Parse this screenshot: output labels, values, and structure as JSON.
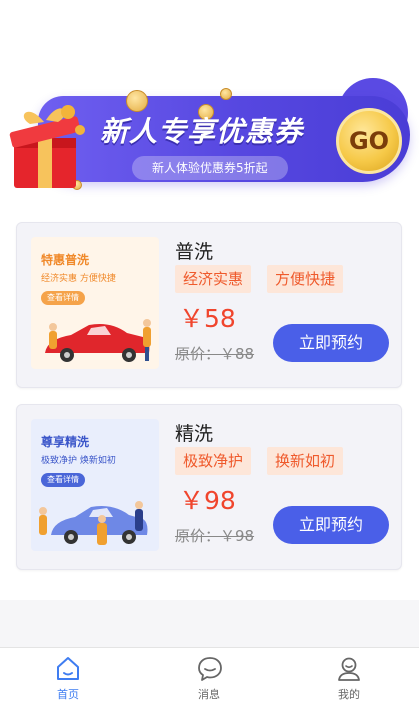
{
  "banner": {
    "title": "新人专享优惠券",
    "subtitle": "新人体验优惠券5折起",
    "go_label": "GO"
  },
  "services": [
    {
      "name": "普洗",
      "tags": [
        "经济实惠",
        "方便快捷"
      ],
      "price": "￥58",
      "original_price": "原价：￥88",
      "book_label": "立即预约",
      "thumb": {
        "title": "特惠普洗",
        "subtitle": "经济实惠  方便快捷",
        "button": "查看详情"
      }
    },
    {
      "name": "精洗",
      "tags": [
        "极致净护",
        "换新如初"
      ],
      "price": "￥98",
      "original_price": "原价：￥98",
      "book_label": "立即预约",
      "thumb": {
        "title": "尊享精洗",
        "subtitle": "极致净护  焕新如初",
        "button": "查看详情"
      }
    }
  ],
  "tabbar": {
    "items": [
      {
        "label": "首页",
        "icon": "home-icon",
        "active": true
      },
      {
        "label": "消息",
        "icon": "chat-icon",
        "active": false
      },
      {
        "label": "我的",
        "icon": "profile-icon",
        "active": false
      }
    ]
  },
  "colors": {
    "accent": "#4a5fe8",
    "price": "#f0452d",
    "tag_bg": "#fde6d9",
    "tag_text": "#ef5a2c",
    "tab_active": "#3f7df1",
    "tab_inactive": "#666666"
  }
}
